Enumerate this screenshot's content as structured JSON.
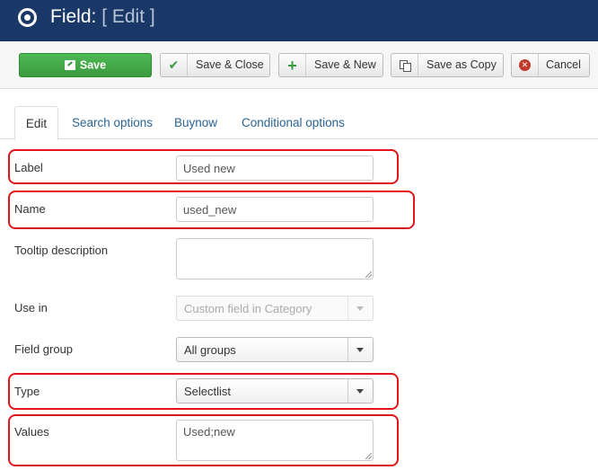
{
  "header": {
    "title": "Field:",
    "subtitle": "[ Edit ]",
    "icon": "target-icon"
  },
  "toolbar": {
    "save_label": "Save",
    "save_close_label": "Save & Close",
    "save_new_label": "Save & New",
    "save_copy_label": "Save as Copy",
    "cancel_label": "Cancel"
  },
  "tabs": [
    {
      "label": "Edit",
      "active": true
    },
    {
      "label": "Search options",
      "active": false
    },
    {
      "label": "Buynow",
      "active": false
    },
    {
      "label": "Conditional options",
      "active": false
    }
  ],
  "form": {
    "label": {
      "label": "Label",
      "value": "Used new"
    },
    "name": {
      "label": "Name",
      "value": "used_new"
    },
    "tooltip": {
      "label": "Tooltip description",
      "value": ""
    },
    "use_in": {
      "label": "Use in",
      "value": "Custom field in Category"
    },
    "field_group": {
      "label": "Field group",
      "value": "All groups"
    },
    "type": {
      "label": "Type",
      "value": "Selectlist"
    },
    "values": {
      "label": "Values",
      "value": "Used;new"
    }
  },
  "colors": {
    "header_bg": "#1a3867",
    "save_green": "#3a9a3f",
    "highlight_red": "#e2141a",
    "link_blue": "#2a6496"
  }
}
